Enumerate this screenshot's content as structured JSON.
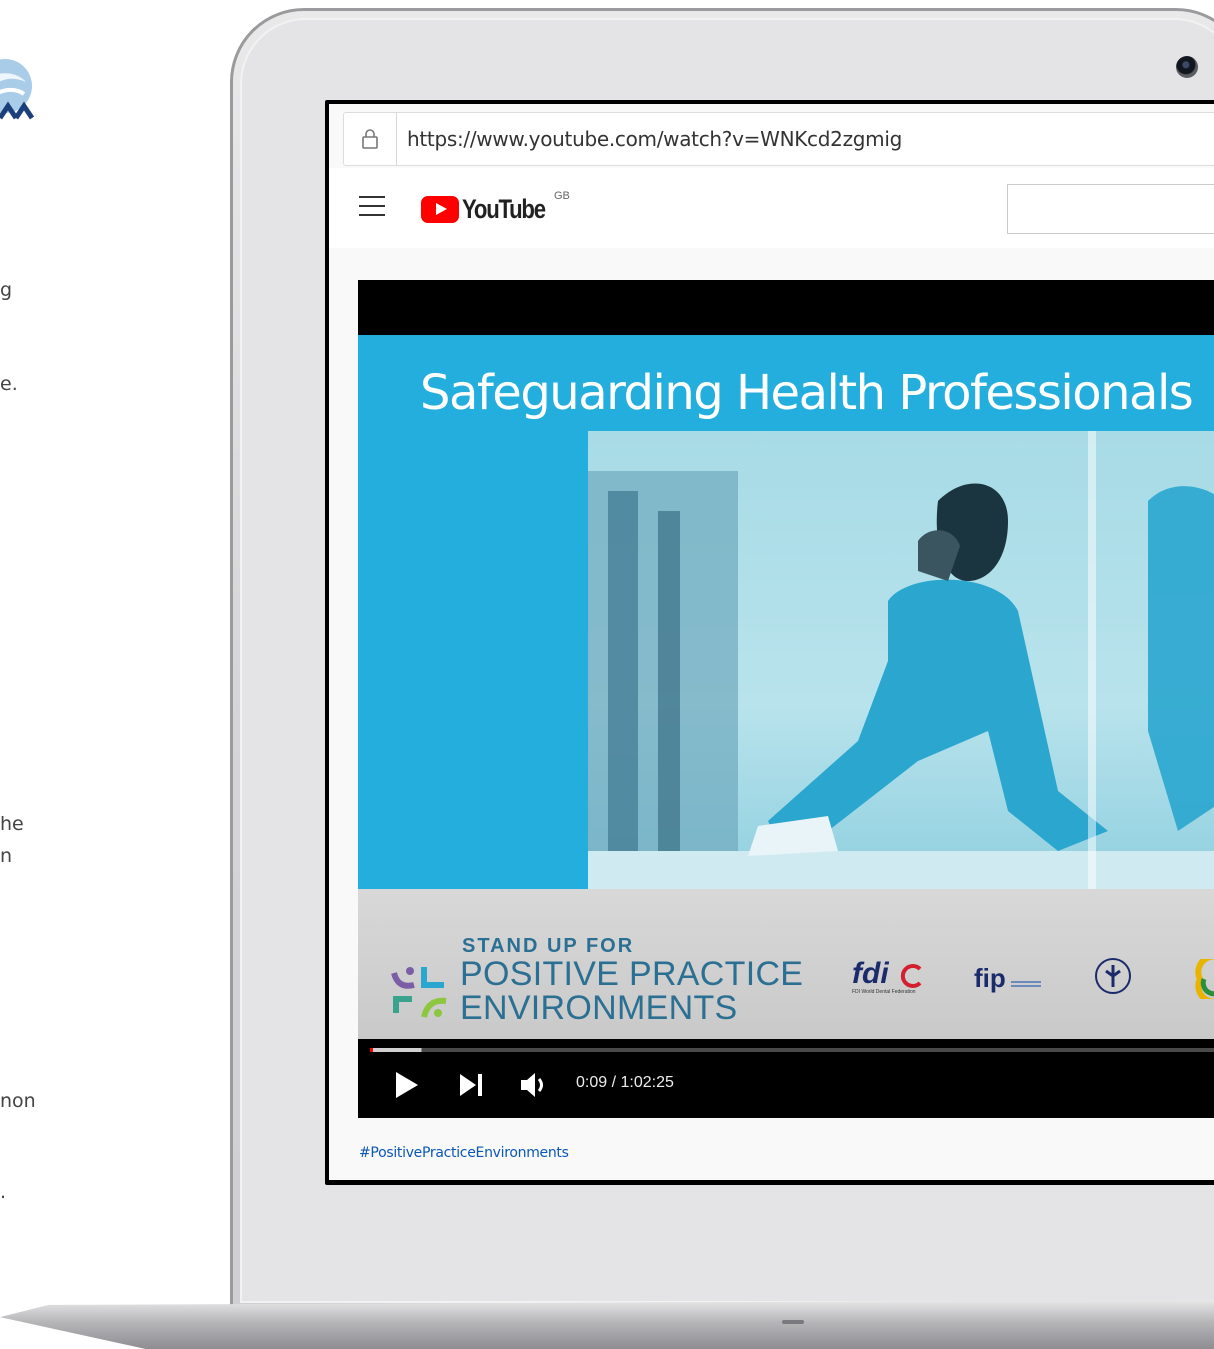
{
  "left_page": {
    "logo_text": "AA",
    "fragments": [
      "g",
      "e.",
      "he",
      "n",
      "non",
      "."
    ]
  },
  "browser": {
    "url": "https://www.youtube.com/watch?v=WNKcd2zgmig"
  },
  "youtube": {
    "logo_text": "YouTube",
    "region": "GB",
    "search_placeholder": ""
  },
  "video": {
    "slide_title": "Safeguarding Health Professionals",
    "campaign_sub": "STAND UP FOR",
    "campaign_line1": "POSITIVE PRACTICE",
    "campaign_line2": "ENVIRONMENTS",
    "partner1": "fdi",
    "partner1_sub": "FDI World Dental Federation",
    "partner2": "fip",
    "time_display": "0:09 / 1:02:25",
    "progress": 0.0024,
    "buffered": 0.06
  },
  "hashtag": "#PositivePracticeEnvironments",
  "colors": {
    "slide_blue": "#24aede",
    "campaign_blue": "#2b6f93",
    "youtube_red": "#ff0000"
  }
}
